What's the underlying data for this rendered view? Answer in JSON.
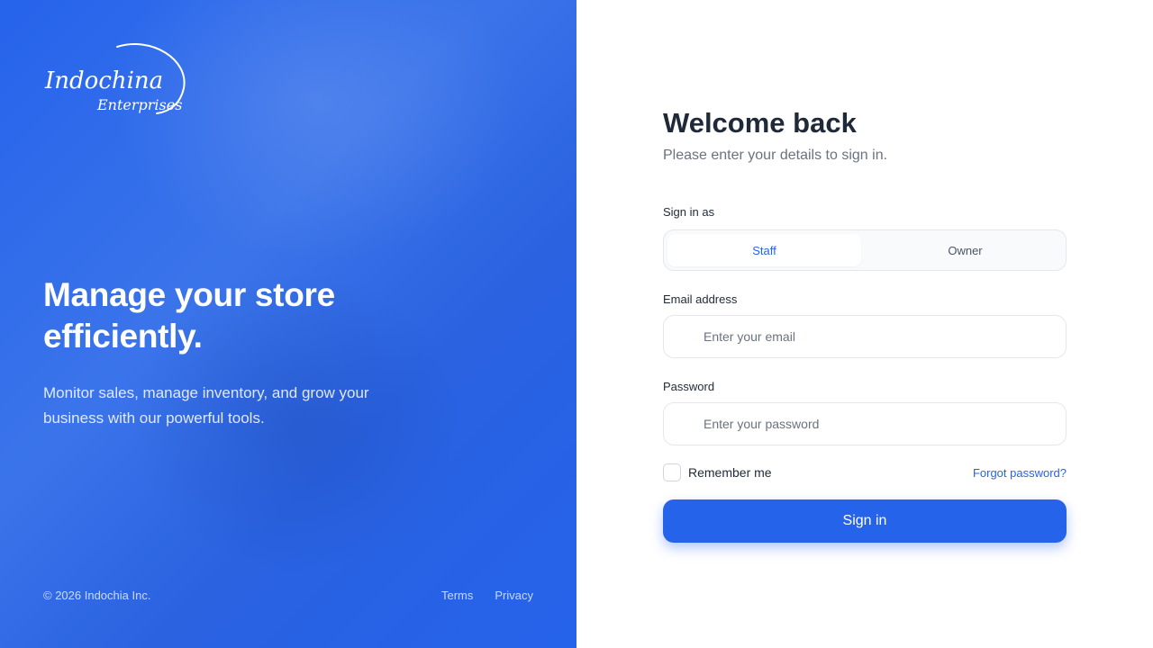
{
  "brand": {
    "logo_line1": "Indochina",
    "logo_line2": "Enterprises"
  },
  "hero": {
    "title": "Manage your store efficiently.",
    "subtitle": "Monitor sales, manage inventory, and grow your business with our powerful tools."
  },
  "left_footer": {
    "copyright": "© 2026 Indochia Inc.",
    "links": [
      "Terms",
      "Privacy"
    ]
  },
  "form": {
    "title": "Welcome back",
    "subtitle": "Please enter your details to sign in.",
    "role_label": "Sign in as",
    "roles": [
      "Staff",
      "Owner"
    ],
    "selected_role": "Staff",
    "email_label": "Email address",
    "email_placeholder": "Enter your email",
    "email_value": "",
    "password_label": "Password",
    "password_placeholder": "Enter your password",
    "password_value": "",
    "remember_label": "Remember me",
    "remember_checked": false,
    "forgot_label": "Forgot password?",
    "submit_label": "Sign in"
  },
  "icons": {
    "email": "mail-icon",
    "password": "lock-icon"
  },
  "colors": {
    "accent": "#2563eb",
    "panel_bg": "#2563eb",
    "title_text": "#1f2937",
    "muted_text": "#6b7280",
    "border": "#e5e7eb"
  }
}
